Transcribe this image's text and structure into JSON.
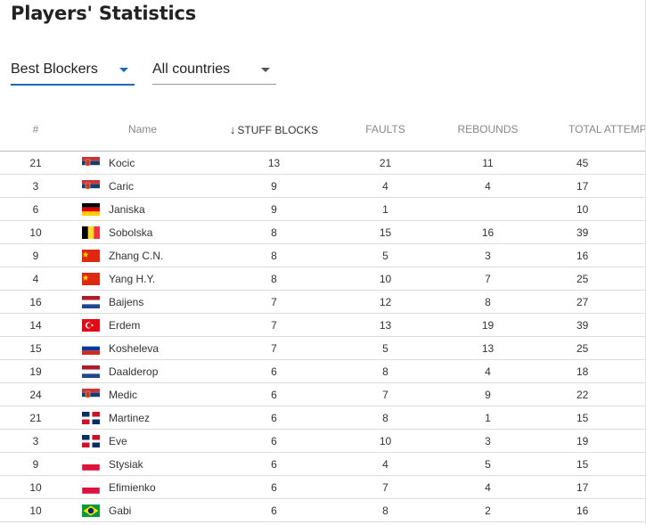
{
  "header": {
    "title": "Players' Statistics"
  },
  "filters": {
    "type": {
      "selected": "Best Blockers"
    },
    "country": {
      "selected": "All countries"
    }
  },
  "table": {
    "columns": {
      "rank": "#",
      "name": "Name",
      "stuff_blocks": "STUFF BLOCKS",
      "faults": "FAULTS",
      "rebounds": "REBOUNDS",
      "total": "TOTAL ATTEMPTS"
    },
    "sort": {
      "column": "stuff_blocks",
      "direction": "descending"
    },
    "rows": [
      {
        "rank": "21",
        "flag": "serbia",
        "name": "Kocic",
        "stuff_blocks": "13",
        "faults": "21",
        "rebounds": "11",
        "total": "45"
      },
      {
        "rank": "3",
        "flag": "serbia",
        "name": "Caric",
        "stuff_blocks": "9",
        "faults": "4",
        "rebounds": "4",
        "total": "17"
      },
      {
        "rank": "6",
        "flag": "germany",
        "name": "Janiska",
        "stuff_blocks": "9",
        "faults": "1",
        "rebounds": "",
        "total": "10"
      },
      {
        "rank": "10",
        "flag": "belgium",
        "name": "Sobolska",
        "stuff_blocks": "8",
        "faults": "15",
        "rebounds": "16",
        "total": "39"
      },
      {
        "rank": "9",
        "flag": "china",
        "name": "Zhang C.N.",
        "stuff_blocks": "8",
        "faults": "5",
        "rebounds": "3",
        "total": "16"
      },
      {
        "rank": "4",
        "flag": "china",
        "name": "Yang H.Y.",
        "stuff_blocks": "8",
        "faults": "10",
        "rebounds": "7",
        "total": "25"
      },
      {
        "rank": "16",
        "flag": "netherlands",
        "name": "Baijens",
        "stuff_blocks": "7",
        "faults": "12",
        "rebounds": "8",
        "total": "27"
      },
      {
        "rank": "14",
        "flag": "turkey",
        "name": "Erdem",
        "stuff_blocks": "7",
        "faults": "13",
        "rebounds": "19",
        "total": "39"
      },
      {
        "rank": "15",
        "flag": "russia",
        "name": "Kosheleva",
        "stuff_blocks": "7",
        "faults": "5",
        "rebounds": "13",
        "total": "25"
      },
      {
        "rank": "19",
        "flag": "netherlands",
        "name": "Daalderop",
        "stuff_blocks": "6",
        "faults": "8",
        "rebounds": "4",
        "total": "18"
      },
      {
        "rank": "24",
        "flag": "serbia",
        "name": "Medic",
        "stuff_blocks": "6",
        "faults": "7",
        "rebounds": "9",
        "total": "22"
      },
      {
        "rank": "21",
        "flag": "dominican-republic",
        "name": "Martinez",
        "stuff_blocks": "6",
        "faults": "8",
        "rebounds": "1",
        "total": "15"
      },
      {
        "rank": "3",
        "flag": "dominican-republic",
        "name": "Eve",
        "stuff_blocks": "6",
        "faults": "10",
        "rebounds": "3",
        "total": "19"
      },
      {
        "rank": "9",
        "flag": "poland",
        "name": "Stysiak",
        "stuff_blocks": "6",
        "faults": "4",
        "rebounds": "5",
        "total": "15"
      },
      {
        "rank": "10",
        "flag": "poland",
        "name": "Efimienko",
        "stuff_blocks": "6",
        "faults": "7",
        "rebounds": "4",
        "total": "17"
      },
      {
        "rank": "10",
        "flag": "brazil",
        "name": "Gabi",
        "stuff_blocks": "6",
        "faults": "8",
        "rebounds": "2",
        "total": "16"
      }
    ]
  },
  "colors": {
    "accent": "#1a6ab8",
    "title": "#222222",
    "header_text": "#888888",
    "cell_text": "#333333",
    "row_border": "#dddddd"
  }
}
